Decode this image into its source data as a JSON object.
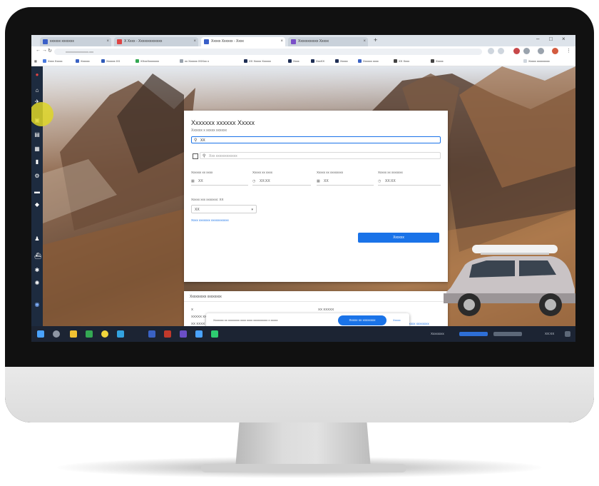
{
  "browser": {
    "tabs": [
      {
        "label": "xxxxxx xxxxxxx"
      },
      {
        "label": "X Xxxx - Xxxxxxxxxxxxx"
      },
      {
        "label": "Xxxxx Xxxxxx - Xxxx"
      },
      {
        "label": "Xxxxxxxxxxx Xxxxx"
      }
    ],
    "new_tab": "+",
    "url": "xxxxxxxxxxxxxxxx.xxx",
    "bookmarks": [
      "Xxxx Xxxxx",
      "Xxxxxx",
      "Xxxxxx XX",
      "XXxxXxxxxxxx",
      "xx Xxxxxx XXXxx x",
      "XX Xxxxx Xxxxxx",
      "Xxxx",
      "XxxXX",
      "Xxxxx",
      "Xxxxxx xxxx",
      "XX Xxxx",
      "Xxxxx",
      "Xxxxx xxxxxxxxx"
    ]
  },
  "form": {
    "title": "Xxxxxxx xxxxxx Xxxxx",
    "subtitle": "Xxxxxx x xxxxx xxxxxx",
    "pickup_value": "XX",
    "return_placeholder": "Xxx xxxxxxxxxxxx",
    "labels": [
      "Xxxxxx xx xxxx",
      "Xxxxx xx xxxx",
      "Xxxxx xx xxxxxxxx",
      "Xxxxx xx xxxxxxx"
    ],
    "values": [
      "XX",
      "XX:XX",
      "XX",
      "XX:XX"
    ],
    "age_label": "Xxxxx xxx xxxxxxx: XX",
    "age_value": "XX",
    "promo_link": "Xxxx xxxxxxx xxxxxxxxxxx",
    "search_button": "Xxxxxx"
  },
  "recent": {
    "title": "Xxxxxxxxx xxxxxxxx",
    "items": [
      "X",
      "XXXXX XX XXXXX XXXXX",
      "XX XXXX",
      "XX XXXXX",
      "XX XXXXX XX - XXXXXXXX",
      "XX XXXX"
    ],
    "links": [
      "Xxxxxxx xxxxxxxx",
      "Xxxxxxx xxxxxxxx"
    ]
  },
  "cookie": {
    "text": "Xxxxxxx xx xxxxxxxx xxxx xxxx xxxxxxxxxx x xxxxx",
    "accept": "Xxxxx xx xxxxxxxx",
    "more": "Xxxxx"
  },
  "taskbar": {
    "tray_text": "Xxxxxxxx",
    "time": "XX:XX"
  }
}
